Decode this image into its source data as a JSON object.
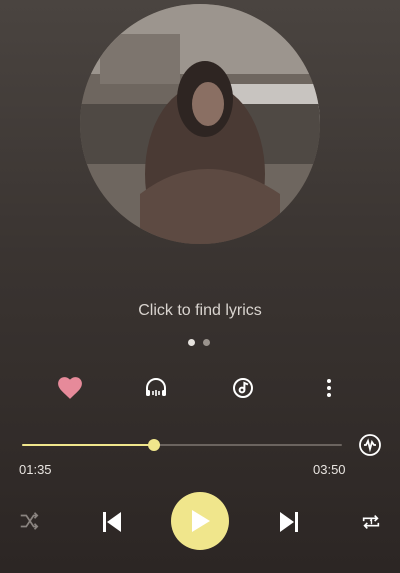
{
  "player": {
    "lyrics_prompt": "Click to find lyrics",
    "current_time": "01:35",
    "total_time": "03:50",
    "progress_fraction": 0.413,
    "page_indicator": {
      "count": 2,
      "active": 0
    },
    "liked": true,
    "playing": false
  },
  "colors": {
    "accent": "#f0e68c",
    "like": "#e68a9a",
    "track": "#6b645f"
  },
  "icons": {
    "like": "heart-icon",
    "listen": "headphones-icon",
    "record": "music-disc-icon",
    "more": "more-vertical-icon",
    "equalizer": "sound-effect-icon",
    "shuffle": "shuffle-icon",
    "previous": "skip-previous-icon",
    "play": "play-icon",
    "next": "skip-next-icon",
    "repeat": "repeat-one-icon"
  }
}
